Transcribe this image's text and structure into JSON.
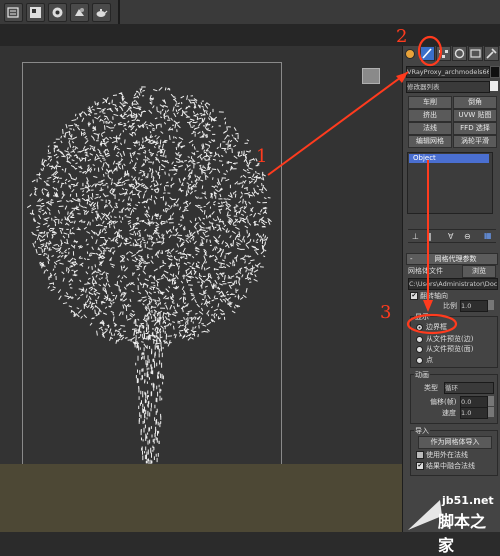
{
  "panel": {
    "object_name": "VRayProxy_archmodels66_02",
    "modifier_list": "修改器列表",
    "modifier_buttons": [
      "车削",
      "倒角",
      "挤出",
      "UVW 贴图",
      "法线",
      "FFD 选择",
      "编辑网格",
      "涡轮平滑"
    ],
    "stack_item": "Object",
    "section_title": "网格代理参数",
    "mesh_file_label": "网格体文件",
    "browse_button": "浏览",
    "path_value": "C:\\Users\\Administrator\\Documents",
    "flip_axis_label": "翻转轴向",
    "scale_label": "比例",
    "scale_value": "1.0",
    "display_label": "显示",
    "display_options": [
      "边界框",
      "从文件预览(边)",
      "从文件预览(面)",
      "点"
    ],
    "selected_display_option": 0,
    "anim_label": "动画",
    "type_label": "类型",
    "type_value": "循环",
    "offset_label": "偏移(帧)",
    "offset_value": "0.0",
    "speed_label": "速度",
    "speed_value": "1.0",
    "import_label": "导入",
    "import_button": "作为网格体导入",
    "use_outside_label": "使用外在法线",
    "merge_label": "结果中融合法线"
  },
  "annotations": {
    "n1": "1",
    "n2": "2",
    "n3": "3",
    "color": "#ff3b1e"
  },
  "watermark": {
    "site": "jb51.net",
    "name": "脚本之家"
  },
  "icons": [
    "open-icon",
    "render-setup-icon",
    "render-frame-icon",
    "render-icon",
    "teapot-render-icon",
    "create-tab-icon",
    "modify-tab-icon",
    "hierarchy-tab-icon",
    "motion-tab-icon",
    "display-tab-icon",
    "utilities-tab-icon",
    "navcube-icon"
  ]
}
